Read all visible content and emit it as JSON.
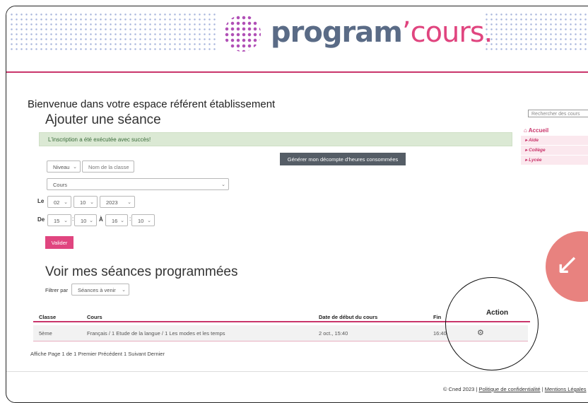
{
  "brand": {
    "logo_main": "program",
    "logo_accent": "’cours."
  },
  "welcome": "Bienvenue dans votre espace référent établissement",
  "add_session": {
    "title": "Ajouter une séance",
    "alert": "L'inscription a été exécutée avec succès!",
    "report_button": "Générer mon décompte d'heures consommées",
    "level_select": "Niveau",
    "class_name_placeholder": "Nom de la classe",
    "course_select": "Cours",
    "date_label": "Le",
    "day": "02",
    "month": "10",
    "year": "2023",
    "time_from_label": "De",
    "from_hour": "15",
    "from_min": "10",
    "time_to_label": "À",
    "to_hour": "16",
    "to_min": "10",
    "colon": ":",
    "submit_label": "Valider"
  },
  "sessions": {
    "title": "Voir mes séances programmées",
    "filter_label": "Filtrer par",
    "filter_value": "Séances à venir",
    "columns": {
      "classe": "Classe",
      "cours": "Cours",
      "debut": "Date de début du cours",
      "fin": "Fin",
      "action": "Action"
    },
    "rows": [
      {
        "classe": "5ème",
        "cours": "Français / 1 Etude de la langue / 1 Les modes et les temps",
        "debut": "2 oct., 15:40",
        "fin": "16:40"
      }
    ],
    "pager": "Affiche Page 1 de 1 Premier Précédent 1 Suivant Dernier"
  },
  "sidebar": {
    "search_placeholder": "Rechercher des cours",
    "home": "Accueil",
    "items": [
      {
        "label": "Aide"
      },
      {
        "label": "Collège"
      },
      {
        "label": "Lycée"
      }
    ]
  },
  "footer": {
    "copyright": "© Cned 2023",
    "sep": "|",
    "privacy": "Politique de confidentialité",
    "legal": "Mentions Légales"
  },
  "colors": {
    "accent": "#c9356b",
    "brand_pink": "#e0457f",
    "success_bg": "#dbe9d4",
    "dark_button": "#555d66"
  },
  "icons": [
    "home-icon",
    "caret-right-icon",
    "gear-icon",
    "chevron-down-icon",
    "arrow-down-left-icon"
  ]
}
